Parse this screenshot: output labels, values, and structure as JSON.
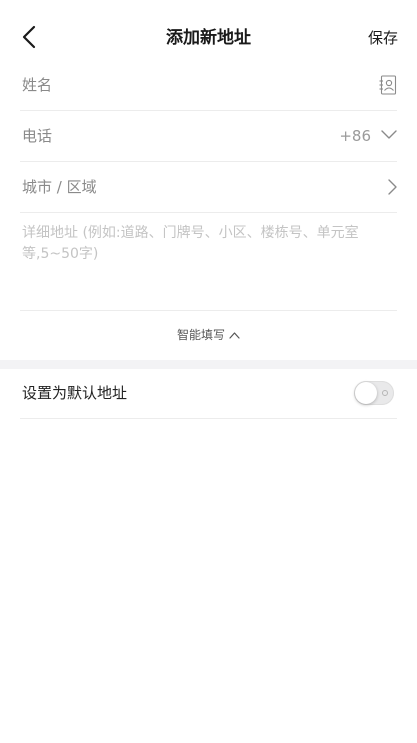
{
  "header": {
    "title": "添加新地址",
    "save_label": "保存"
  },
  "form": {
    "name_label": "姓名",
    "phone_label": "电话",
    "country_code": "+86",
    "region_label": "城市 / 区域",
    "detail_placeholder": "详细地址 (例如:道路、门牌号、小区、楼栋号、单元室等,5~50字)",
    "detail_value": ""
  },
  "smart_fill": {
    "label": "智能填写"
  },
  "default_address": {
    "label": "设置为默认地址",
    "enabled": false
  },
  "icons": {
    "back": "chevron-left-icon",
    "contact": "contact-book-icon",
    "phone_dropdown": "chevron-down-icon",
    "region_arrow": "chevron-right-icon",
    "smart_fill": "chevron-up-icon"
  }
}
